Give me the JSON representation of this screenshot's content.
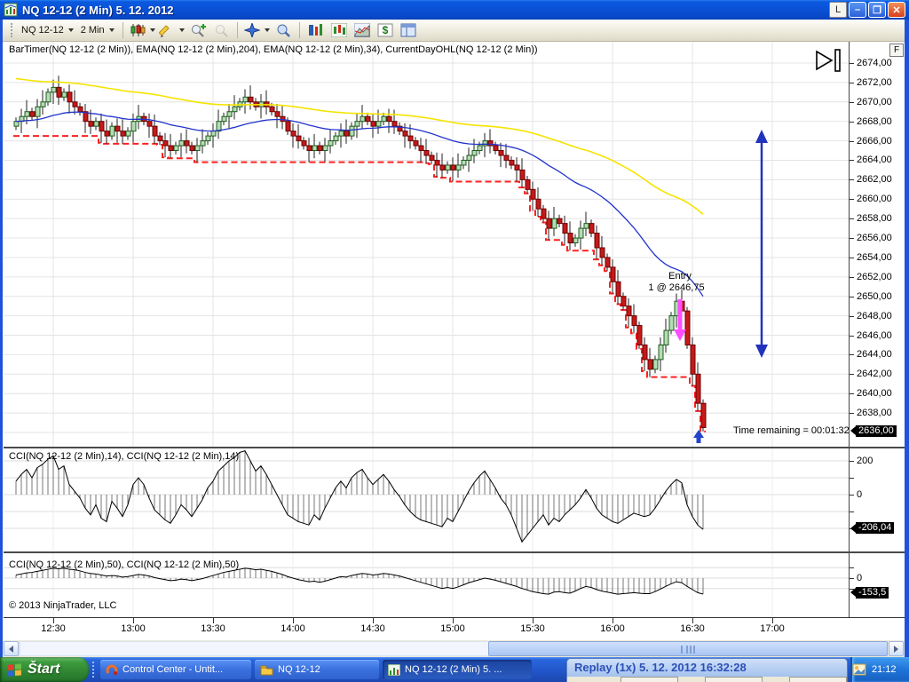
{
  "window": {
    "title": "NQ 12-12 (2 Min)  5. 12. 2012",
    "controls": {
      "lock": "L",
      "minimize": "–",
      "maximize": "❐",
      "close": "✕"
    }
  },
  "toolbar": {
    "instrument": "NQ 12-12",
    "interval": "2 Min",
    "icons": [
      "chart-style",
      "drawing-tools",
      "zoom-in",
      "zoom-out",
      "crosshair",
      "data-box",
      "chart-trader",
      "bars-panel",
      "regions",
      "account-dollar",
      "properties"
    ]
  },
  "chart": {
    "indicator_label": "BarTimer(NQ 12-12 (2 Min)), EMA(NQ 12-12 (2 Min),204), EMA(NQ 12-12 (2 Min),34), CurrentDayOHL(NQ 12-12 (2 Min))",
    "f_button": "F",
    "cci1_label": "CCI(NQ 12-12 (2 Min),14), CCI(NQ 12-12 (2 Min),14)",
    "cci2_label": "CCI(NQ 12-12 (2 Min),50), CCI(NQ 12-12 (2 Min),50)",
    "copyright": "© 2013 NinjaTrader, LLC",
    "colors": {
      "up_fill": "#b5dcb5",
      "up_stroke": "#1f5c1f",
      "down_fill": "#c41a1a",
      "down_stroke": "#6b0000",
      "ema_fast": "#2233cc",
      "ema_slow": "#f5e400",
      "day_low": "#ff2020",
      "grid": "#e4e4e4",
      "arrow_blue": "#2233bb",
      "arrow_magenta": "#ff4dff"
    }
  },
  "annotations": {
    "entry_line1": "Entry",
    "entry_line2": "1 @ 2646,75",
    "time_remaining": "Time remaining = 00:01:32"
  },
  "chart_data": [
    {
      "type": "candlestick",
      "title": "NQ 12-12 (2 Min)",
      "y_axis": {
        "max": 2674,
        "min_label": 2636,
        "step": 2
      },
      "last_price_label": "2636,00",
      "day_low_start": 2666.5,
      "ema_slow_start": 2672.5,
      "x_labels": [
        "12:30",
        "13:00",
        "13:30",
        "14:00",
        "14:30",
        "15:00",
        "15:30",
        "16:00",
        "16:30",
        "17:00"
      ],
      "closes": [
        2668,
        2668.5,
        2669,
        2668.5,
        2669.5,
        2670,
        2671,
        2671.5,
        2670.5,
        2671,
        2670,
        2669.5,
        2669,
        2668,
        2667.5,
        2668,
        2667,
        2666.5,
        2667.5,
        2667,
        2666.5,
        2667,
        2668,
        2668.5,
        2668,
        2667.5,
        2666.5,
        2666,
        2665.5,
        2665,
        2665.5,
        2666,
        2665.5,
        2665,
        2665.5,
        2666,
        2666.5,
        2667,
        2668,
        2668.5,
        2669,
        2669.5,
        2670,
        2670.5,
        2670,
        2669.5,
        2670,
        2669.5,
        2669,
        2668.5,
        2668,
        2667,
        2666.5,
        2666,
        2665.5,
        2665,
        2665.5,
        2665,
        2665.5,
        2666,
        2666.5,
        2667,
        2666.5,
        2667.5,
        2668,
        2668.5,
        2668,
        2667.5,
        2668,
        2668.5,
        2668,
        2667.5,
        2667,
        2666.5,
        2666,
        2665.5,
        2665,
        2664.5,
        2664,
        2663.5,
        2663,
        2663.5,
        2663,
        2663.5,
        2664,
        2664.5,
        2665,
        2665.5,
        2666,
        2665.5,
        2665,
        2664.5,
        2664,
        2663.5,
        2663,
        2662,
        2661,
        2660,
        2659,
        2658,
        2657,
        2658,
        2657.5,
        2656.5,
        2655.5,
        2656,
        2657,
        2657.5,
        2656.5,
        2655,
        2654,
        2653,
        2651.5,
        2650,
        2649,
        2648,
        2647,
        2645,
        2643.5,
        2642.5,
        2643.5,
        2645,
        2646.5,
        2648,
        2649.5,
        2648.5,
        2645,
        2642,
        2639,
        2636.5
      ]
    },
    {
      "type": "line-histogram",
      "name": "CCI(14)",
      "y_ticks_labeled": [
        200,
        0
      ],
      "last_value_label": "-206,04",
      "values": [
        80,
        120,
        150,
        100,
        160,
        180,
        210,
        230,
        150,
        170,
        60,
        20,
        -20,
        -80,
        -120,
        -60,
        -140,
        -160,
        -40,
        -80,
        -130,
        -60,
        60,
        100,
        60,
        -20,
        -90,
        -120,
        -150,
        -170,
        -120,
        -60,
        -90,
        -130,
        -80,
        -30,
        40,
        80,
        140,
        170,
        200,
        220,
        250,
        260,
        200,
        140,
        170,
        120,
        60,
        0,
        -60,
        -120,
        -140,
        -160,
        -170,
        -180,
        -120,
        -150,
        -80,
        -20,
        40,
        80,
        40,
        100,
        130,
        150,
        100,
        60,
        90,
        120,
        80,
        30,
        -10,
        -60,
        -100,
        -130,
        -150,
        -160,
        -170,
        -180,
        -190,
        -140,
        -160,
        -100,
        -40,
        20,
        70,
        110,
        140,
        90,
        40,
        -20,
        -60,
        -120,
        -200,
        -280,
        -240,
        -200,
        -160,
        -120,
        -180,
        -140,
        -160,
        -120,
        -90,
        -60,
        -20,
        30,
        -20,
        -80,
        -120,
        -140,
        -160,
        -170,
        -150,
        -130,
        -110,
        -120,
        -130,
        -120,
        -80,
        -30,
        20,
        60,
        90,
        70,
        -60,
        -130,
        -180,
        -206
      ]
    },
    {
      "type": "line-histogram",
      "name": "CCI(50)",
      "y_ticks_labeled": [
        0
      ],
      "last_value_label": "-153,5",
      "values": [
        30,
        40,
        50,
        55,
        65,
        75,
        85,
        95,
        90,
        95,
        85,
        80,
        70,
        55,
        45,
        40,
        30,
        20,
        25,
        20,
        10,
        15,
        25,
        35,
        30,
        20,
        5,
        -5,
        -15,
        -25,
        -20,
        -10,
        -15,
        -25,
        -15,
        -5,
        10,
        25,
        40,
        55,
        65,
        75,
        85,
        95,
        90,
        80,
        85,
        75,
        65,
        50,
        35,
        15,
        0,
        -15,
        -25,
        -35,
        -30,
        -40,
        -30,
        -15,
        0,
        15,
        10,
        25,
        35,
        45,
        40,
        30,
        35,
        45,
        40,
        30,
        20,
        5,
        -10,
        -25,
        -40,
        -55,
        -70,
        -85,
        -100,
        -90,
        -100,
        -85,
        -65,
        -45,
        -30,
        -15,
        0,
        -10,
        -20,
        -35,
        -50,
        -65,
        -80,
        -100,
        -115,
        -130,
        -140,
        -150,
        -155,
        -135,
        -130,
        -140,
        -145,
        -125,
        -100,
        -80,
        -90,
        -110,
        -125,
        -135,
        -145,
        -155,
        -150,
        -145,
        -140,
        -145,
        -150,
        -150,
        -130,
        -105,
        -80,
        -55,
        -35,
        -45,
        -80,
        -110,
        -140,
        -153.5
      ]
    }
  ],
  "taskbar": {
    "start_label": "Štart",
    "tasks": [
      {
        "label": "Control Center - Untit...",
        "icon": "ninjatrader-icon"
      },
      {
        "label": "NQ 12-12",
        "icon": "folder-icon"
      },
      {
        "label": "NQ 12-12 (2 Min)  5. ...",
        "icon": "chart-icon"
      }
    ],
    "replay_title": "Replay (1x) 5. 12. 2012 16:32:28",
    "clock": "21:12"
  }
}
